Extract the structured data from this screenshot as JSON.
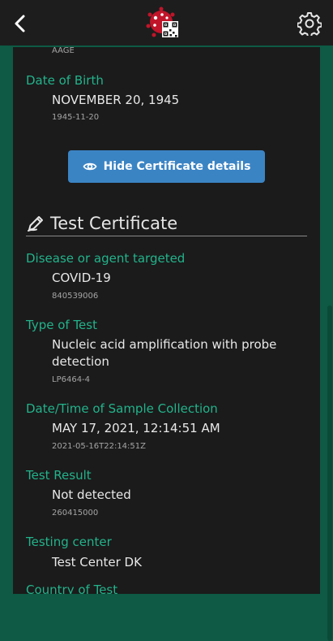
{
  "colors": {
    "accent": "#22b38a",
    "button": "#3b84c4",
    "background": "#0e5a44",
    "panel": "#1b1b1b",
    "topbar": "#1d1d1d"
  },
  "topbar": {
    "back_icon": "chevron-left-icon",
    "logo_icon": "virus-qr-logo",
    "settings_icon": "gear-icon"
  },
  "person": {
    "partial_code": "AAGE",
    "dob_label": "Date of Birth",
    "dob_value": "NOVEMBER 20, 1945",
    "dob_code": "1945-11-20"
  },
  "hide_button": {
    "icon": "eye-icon",
    "label": "Hide Certificate details"
  },
  "section": {
    "icon": "pencil-icon",
    "title": "Test Certificate"
  },
  "fields": [
    {
      "label": "Disease or agent targeted",
      "value": "COVID-19",
      "code": "840539006"
    },
    {
      "label": "Type of Test",
      "value": "Nucleic acid amplification with probe",
      "value2": "detection",
      "code": "LP6464-4"
    },
    {
      "label": "Date/Time of Sample Collection",
      "value": "MAY 17, 2021, 12:14:51 AM",
      "code": "2021-05-16T22:14:51Z"
    },
    {
      "label": "Test Result",
      "value": "Not detected",
      "code": "260415000"
    },
    {
      "label": "Testing center",
      "value": "Test Center DK"
    },
    {
      "label": "Country of Test"
    }
  ]
}
